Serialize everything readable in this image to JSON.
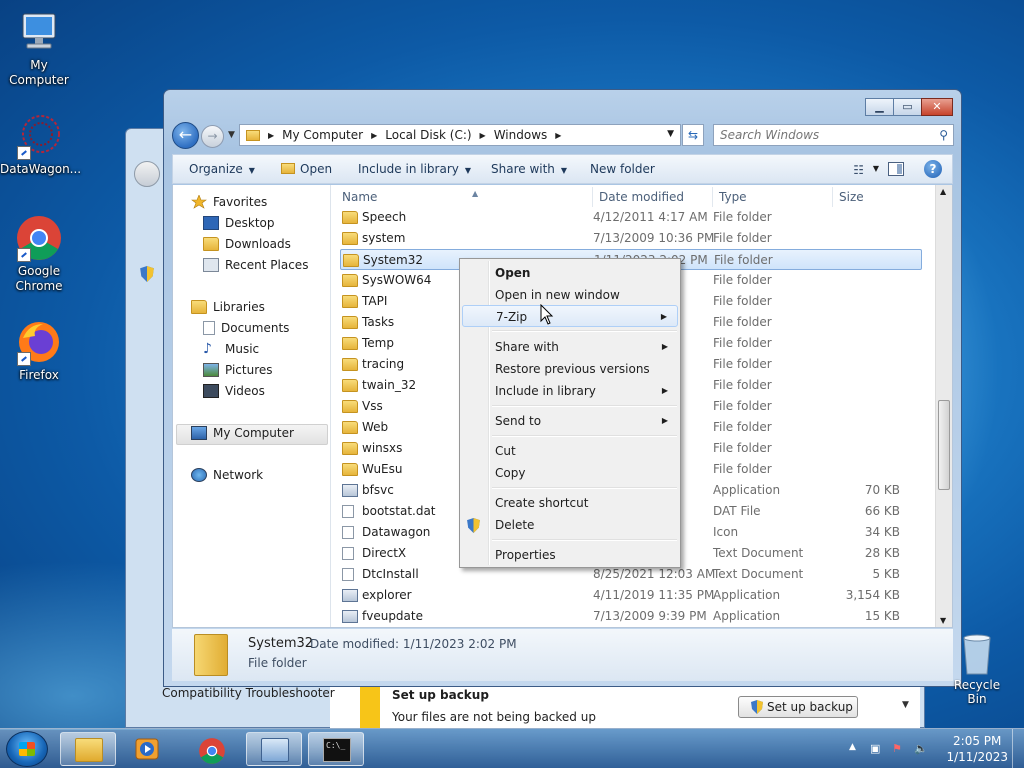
{
  "desktop": {
    "icons": [
      {
        "label": "My Computer"
      },
      {
        "label": "DataWagon..."
      },
      {
        "label": "Google Chrome"
      },
      {
        "label": "Firefox"
      }
    ],
    "recycle_bin": "Recycle Bin"
  },
  "background_window": {
    "compat": "Compatibility Troubleshooter",
    "backup_title": "Set up backup",
    "backup_sub": "Your files are not being backed up",
    "backup_button": "Set up backup"
  },
  "explorer": {
    "breadcrumb": [
      "My Computer",
      "Local Disk (C:)",
      "Windows"
    ],
    "search_placeholder": "Search Windows",
    "toolbar": {
      "organize": "Organize",
      "open": "Open",
      "include": "Include in library",
      "share": "Share with",
      "new_folder": "New folder"
    },
    "nav": {
      "favorites": "Favorites",
      "desktop": "Desktop",
      "downloads": "Downloads",
      "recent": "Recent Places",
      "libraries": "Libraries",
      "documents": "Documents",
      "music": "Music",
      "pictures": "Pictures",
      "videos": "Videos",
      "computer": "My Computer",
      "network": "Network"
    },
    "columns": {
      "name": "Name",
      "date": "Date modified",
      "type": "Type",
      "size": "Size"
    },
    "rows": [
      {
        "name": "Speech",
        "date": "4/12/2011 4:17 AM",
        "type": "File folder",
        "size": ""
      },
      {
        "name": "system",
        "date": "7/13/2009 10:36 PM",
        "type": "File folder",
        "size": ""
      },
      {
        "name": "System32",
        "date": "1/11/2023 2:02 PM",
        "type": "File folder",
        "size": ""
      },
      {
        "name": "SysWOW64",
        "date": "57 PM",
        "type": "File folder",
        "size": ""
      },
      {
        "name": "TAPI",
        "date": "57 AM",
        "type": "File folder",
        "size": ""
      },
      {
        "name": "Tasks",
        "date": "AM",
        "type": "File folder",
        "size": ""
      },
      {
        "name": "Temp",
        "date": "7 PM",
        "type": "File folder",
        "size": ""
      },
      {
        "name": "tracing",
        "date": "7 PM",
        "type": "File folder",
        "size": ""
      },
      {
        "name": "twain_32",
        "date": "5 PM",
        "type": "File folder",
        "size": ""
      },
      {
        "name": "Vss",
        "date": "20 PM",
        "type": "File folder",
        "size": ""
      },
      {
        "name": "Web",
        "date": "2 AM",
        "type": "File folder",
        "size": ""
      },
      {
        "name": "winsxs",
        "date": "4 PM",
        "type": "File folder",
        "size": ""
      },
      {
        "name": "WuEsu",
        "date": "9 PM",
        "type": "File folder",
        "size": ""
      },
      {
        "name": "bfsvc",
        "date": "24 ...",
        "type": "Application",
        "size": "70 KB"
      },
      {
        "name": "bootstat.dat",
        "date": "5 PM",
        "type": "DAT File",
        "size": "66 KB"
      },
      {
        "name": "Datawagon",
        "date": "8 PM",
        "type": "Icon",
        "size": "34 KB"
      },
      {
        "name": "DirectX",
        "date": "3 AM",
        "type": "Text Document",
        "size": "28 KB"
      },
      {
        "name": "DtcInstall",
        "date": "8/25/2021 12:03 AM",
        "type": "Text Document",
        "size": "5 KB"
      },
      {
        "name": "explorer",
        "date": "4/11/2019 11:35 PM",
        "type": "Application",
        "size": "3,154 KB"
      },
      {
        "name": "fveupdate",
        "date": "7/13/2009 9:39 PM",
        "type": "Application",
        "size": "15 KB"
      }
    ],
    "details": {
      "name": "System32",
      "meta": "Date modified: 1/11/2023 2:02 PM",
      "kind": "File folder"
    }
  },
  "context_menu": {
    "open": "Open",
    "open_new": "Open in new window",
    "zip": "7-Zip",
    "share": "Share with",
    "restore": "Restore previous versions",
    "include": "Include in library",
    "send": "Send to",
    "cut": "Cut",
    "copy": "Copy",
    "shortcut": "Create shortcut",
    "delete": "Delete",
    "properties": "Properties"
  },
  "taskbar": {
    "time": "2:05 PM",
    "date": "1/11/2023"
  }
}
